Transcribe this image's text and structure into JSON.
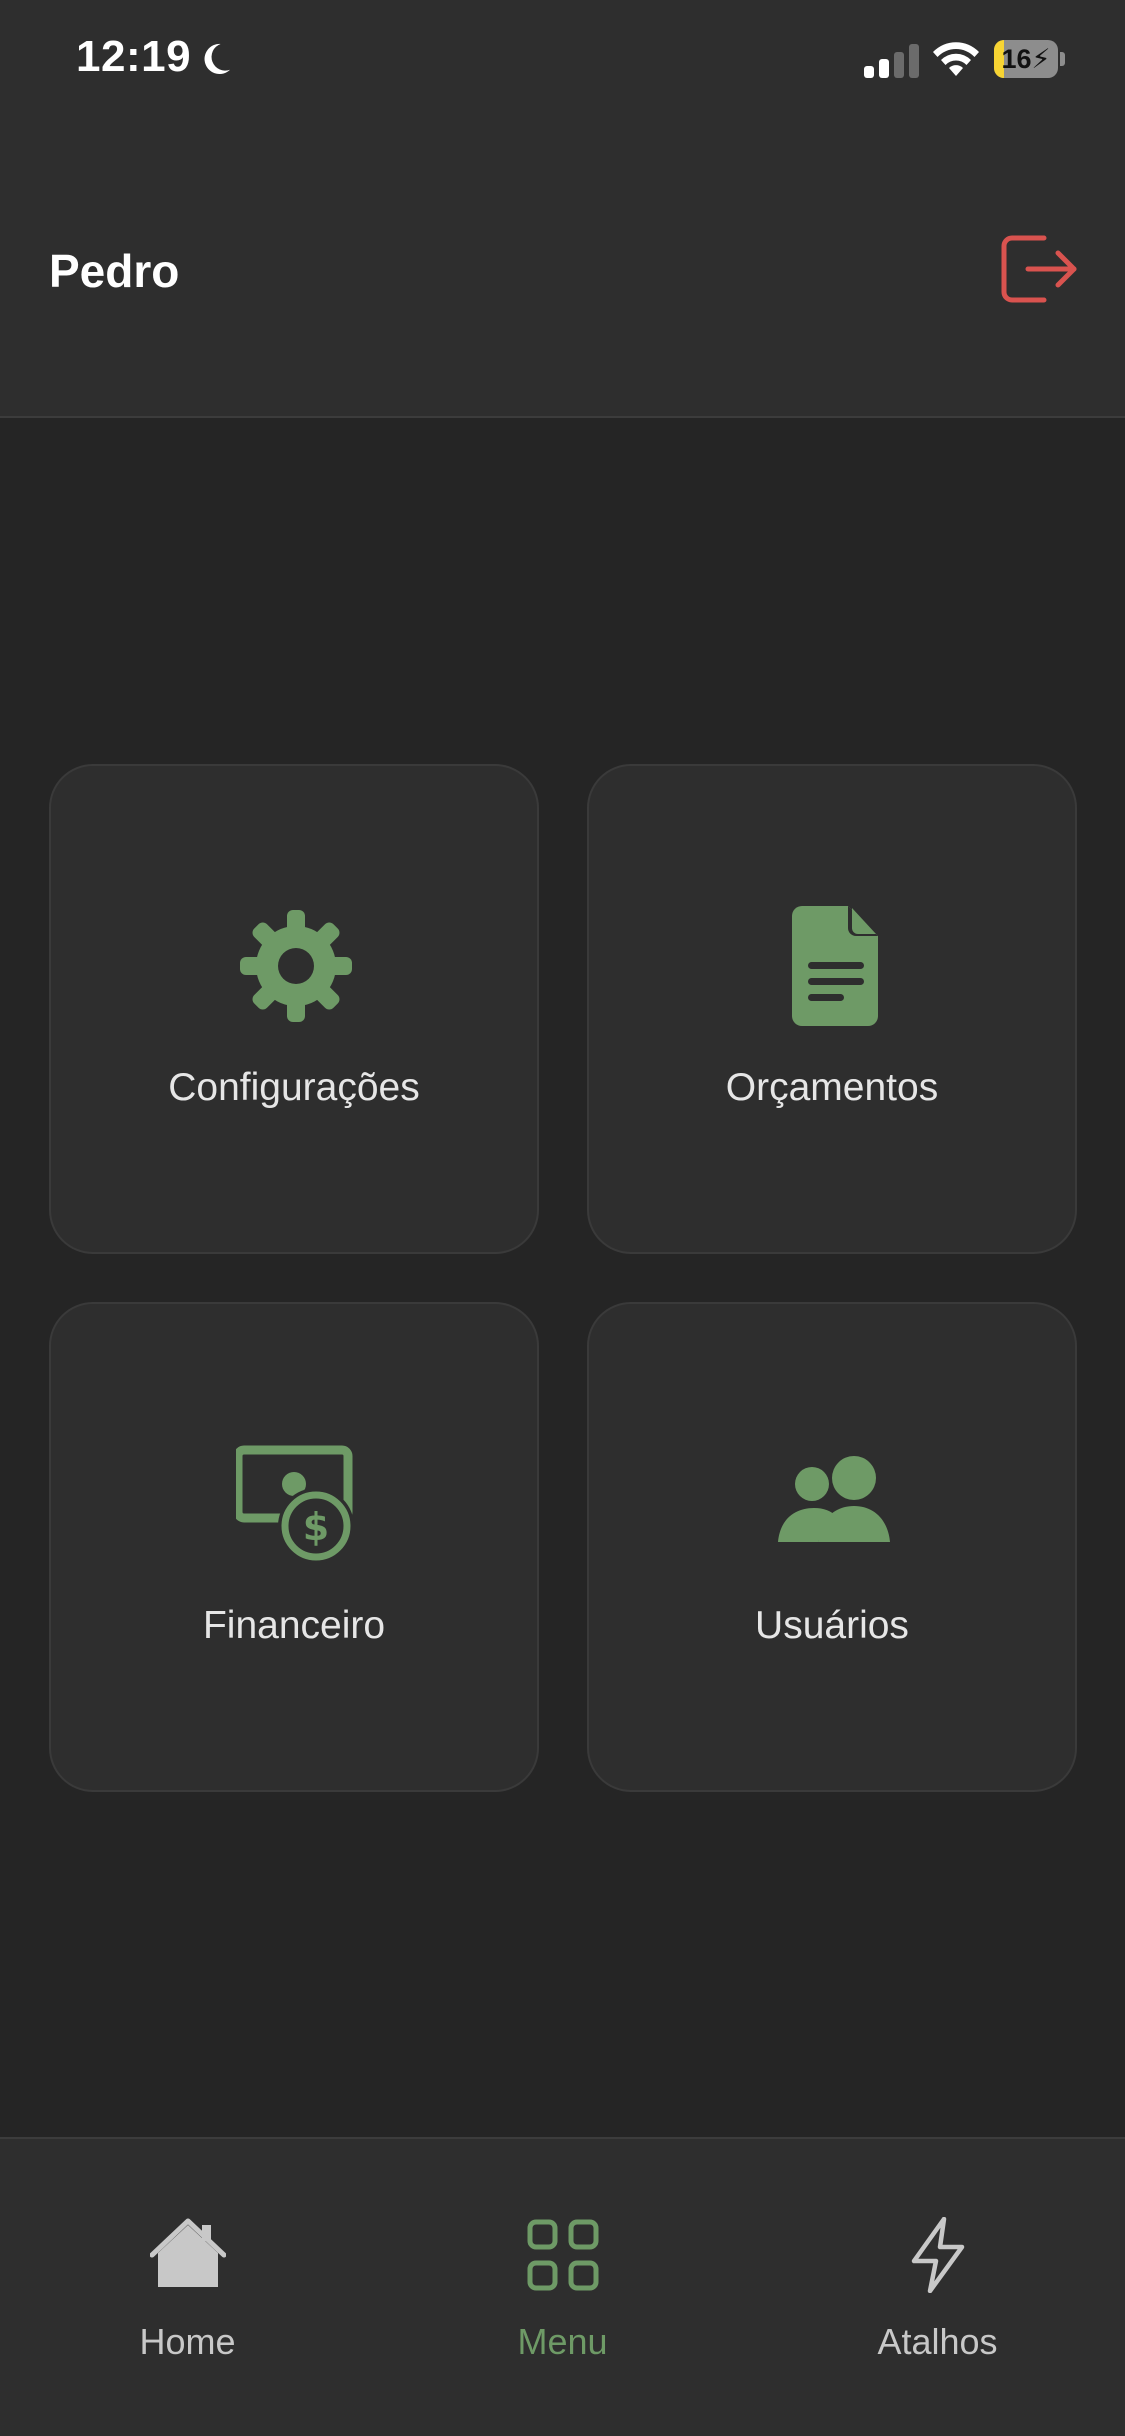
{
  "status_bar": {
    "time": "12:19",
    "battery_level": "16",
    "battery_fraction": 0.16,
    "icons": [
      "moon-icon",
      "signal-icon",
      "wifi-icon",
      "battery-icon"
    ]
  },
  "header": {
    "user_name": "Pedro",
    "logout_icon": "logout-icon"
  },
  "menu": {
    "items": [
      {
        "label": "Configurações",
        "icon": "gear-icon"
      },
      {
        "label": "Orçamentos",
        "icon": "document-icon"
      },
      {
        "label": "Financeiro",
        "icon": "money-icon"
      },
      {
        "label": "Usuários",
        "icon": "users-icon"
      }
    ]
  },
  "tabs": [
    {
      "label": "Home",
      "icon": "home-icon",
      "active": false
    },
    {
      "label": "Menu",
      "icon": "grid-icon",
      "active": true
    },
    {
      "label": "Atalhos",
      "icon": "lightning-icon",
      "active": false
    }
  ],
  "colors": {
    "accent": "#6e9a66",
    "logout": "#d9534f",
    "background": "#252525",
    "surface": "#2e2e2e",
    "inactive_tab": "#c8c8c8"
  }
}
